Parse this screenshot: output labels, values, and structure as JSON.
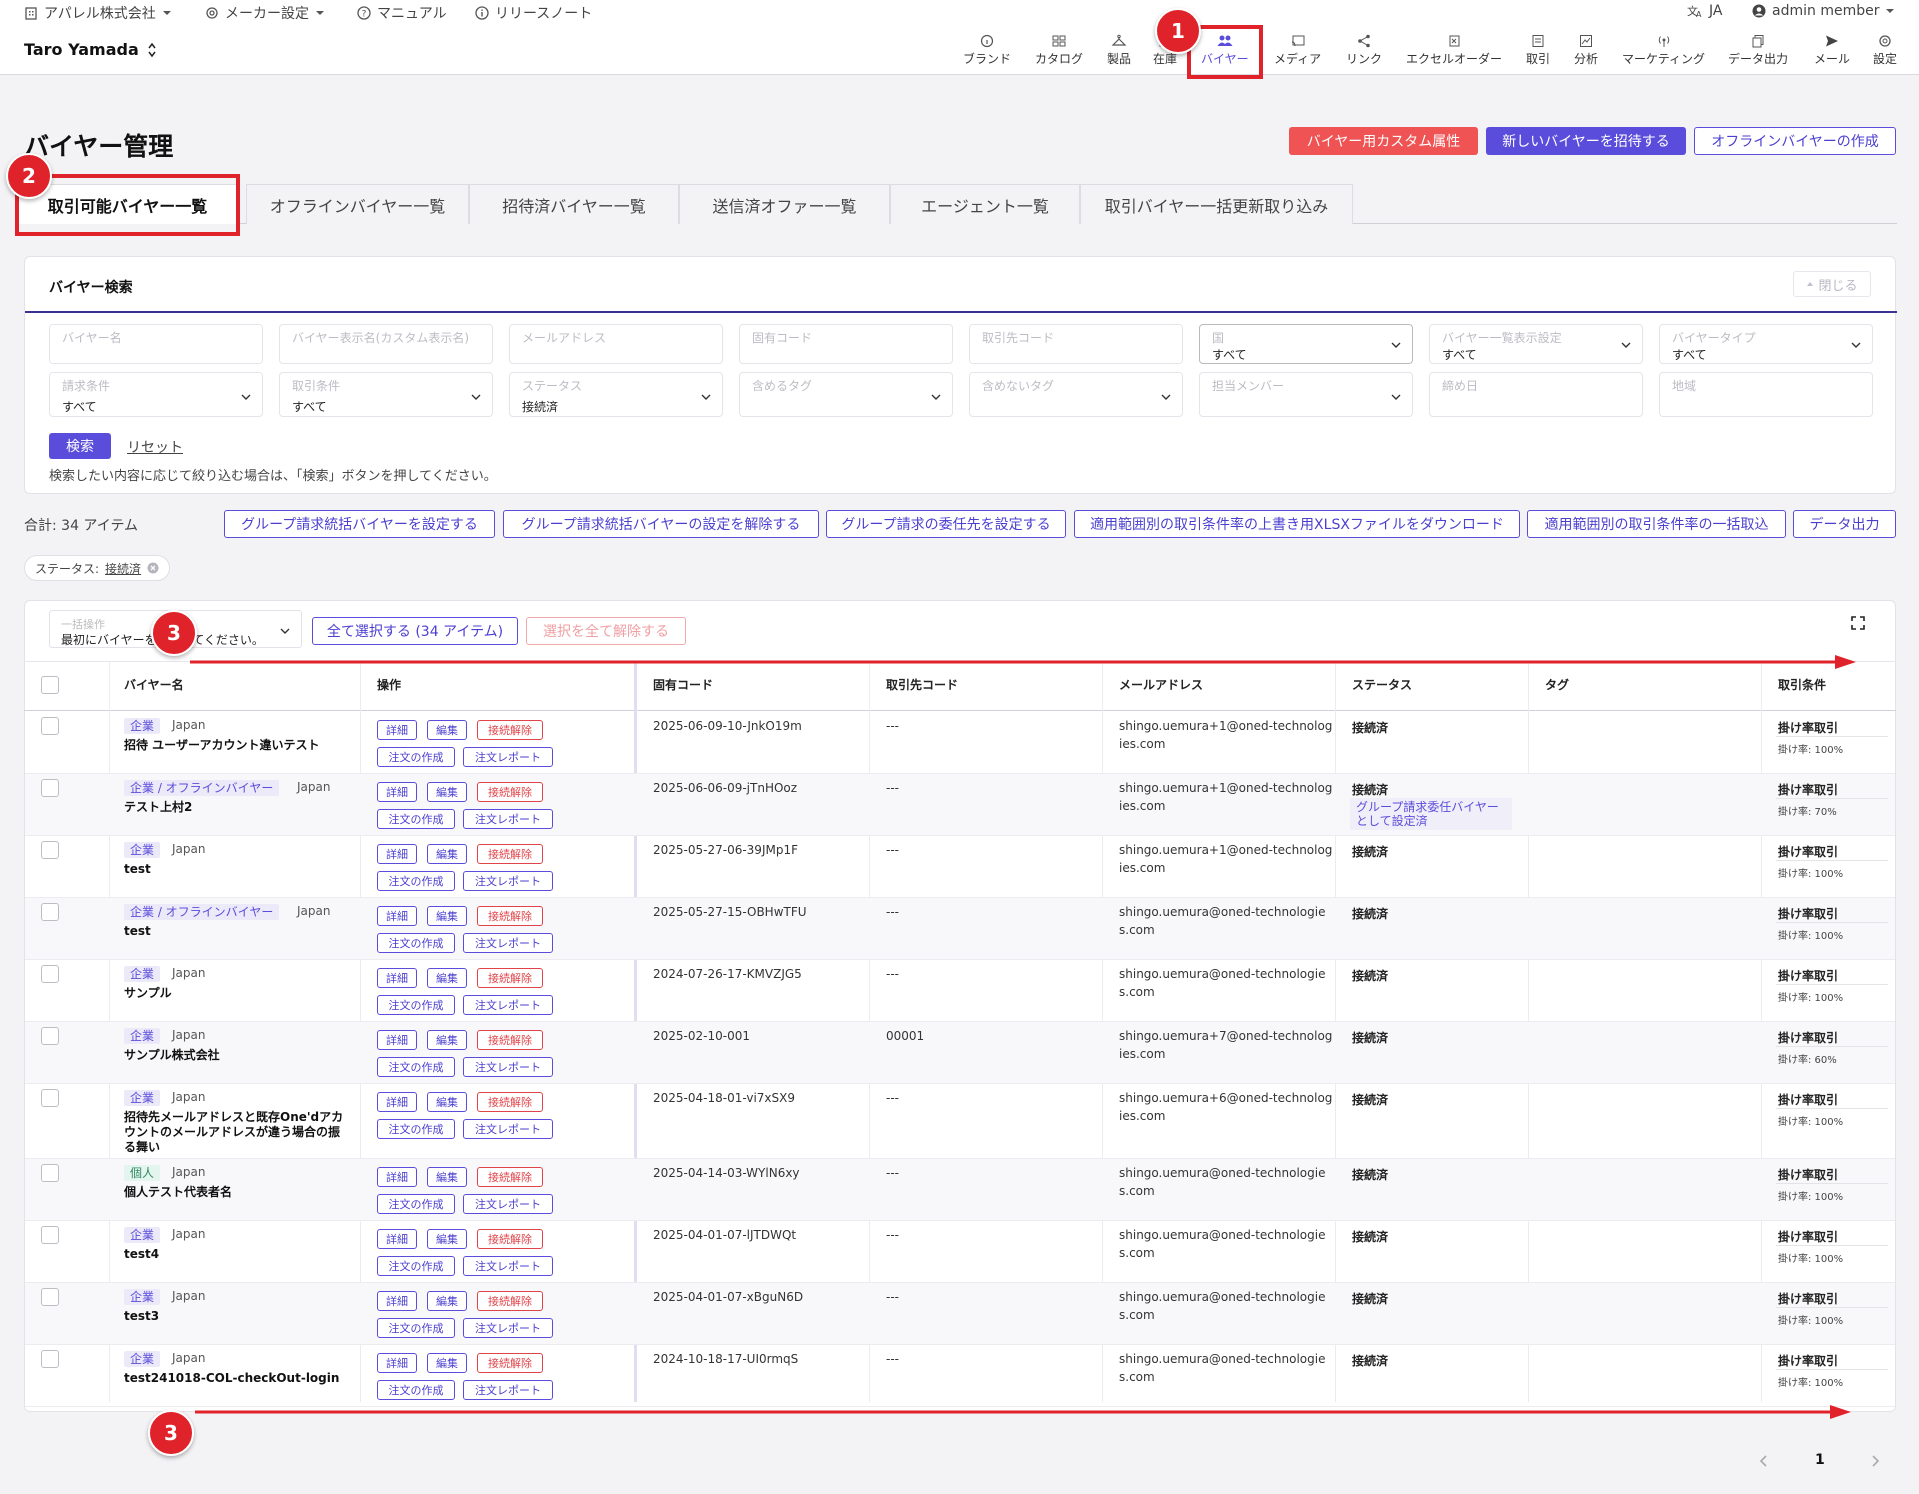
{
  "topbar": {
    "company": "アパレル株式会社",
    "maker_settings": "メーカー設定",
    "manual": "マニュアル",
    "release_notes": "リリースノート",
    "lang": "JA",
    "account": "admin member"
  },
  "nav": {
    "user": "Taro Yamada",
    "items": [
      "ブランド",
      "カタログ",
      "製品",
      "在庫",
      "バイヤー",
      "メディア",
      "リンク",
      "エクセルオーダー",
      "取引",
      "分析",
      "マーケティング",
      "データ出力",
      "メール",
      "設定"
    ]
  },
  "page": {
    "title": "バイヤー管理",
    "btn_custom_attr": "バイヤー用カスタム属性",
    "btn_invite": "新しいバイヤーを招待する",
    "btn_offline": "オフラインバイヤーの作成"
  },
  "tabs": [
    "取引可能バイヤー一覧",
    "オフラインバイヤー一覧",
    "招待済バイヤー一覧",
    "送信済オファー一覧",
    "エージェント一覧",
    "取引バイヤー一括更新取り込み"
  ],
  "search": {
    "title": "バイヤー検索",
    "close": "閉じる",
    "fields": {
      "buyer_name": "バイヤー名",
      "display_name": "バイヤー表示名(カスタム表示名)",
      "email": "メールアドレス",
      "code": "固有コード",
      "partner_code": "取引先コード",
      "country_label": "国",
      "country_value": "すべて",
      "list_setting_label": "バイヤー一覧表示設定",
      "list_setting_value": "すべて",
      "type_label": "バイヤータイプ",
      "type_value": "すべて",
      "billing_label": "請求条件",
      "billing_value": "すべて",
      "trade_label": "取引条件",
      "trade_value": "すべて",
      "status_label": "ステータス",
      "status_value": "接続済",
      "include_tags": "含めるタグ",
      "exclude_tags": "含めないタグ",
      "member": "担当メンバー",
      "closing_day": "締め日",
      "region": "地域"
    },
    "btn_search": "検索",
    "btn_reset": "リセット",
    "hint": "検索したい内容に応じて絞り込む場合は、「検索」ボタンを押してください。"
  },
  "actions": {
    "total": "合計: 34 アイテム",
    "b1": "グループ請求統括バイヤーを設定する",
    "b2": "グループ請求統括バイヤーの設定を解除する",
    "b3": "グループ請求の委任先を設定する",
    "b4": "適用範囲別の取引条件率の上書き用XLSXファイルをダウンロード",
    "b5": "適用範囲別の取引条件率の一括取込",
    "b6": "データ出力",
    "filter_chip_prefix": "ステータス: ",
    "filter_chip_value": "接続済"
  },
  "bulk": {
    "label": "一括操作",
    "value": "最初にバイヤーを選択してください。",
    "select_all": "全て選択する (34 アイテム)",
    "deselect_all": "選択を全て解除する"
  },
  "table": {
    "headers": [
      "バイヤー名",
      "操作",
      "固有コード",
      "取引先コード",
      "メールアドレス",
      "ステータス",
      "タグ",
      "取引条件"
    ],
    "btn_detail": "詳細",
    "btn_edit": "編集",
    "btn_disconnect": "接続解除",
    "btn_order": "注文の作成",
    "btn_report": "注文レポート",
    "rows": [
      {
        "type": "企業",
        "country": "Japan",
        "name1": "招待 ユーザーアカウント違いテスト",
        "name2": "",
        "name3": "",
        "code": "2025-06-09-10-JnkO19m",
        "partner": "---",
        "email1": "shingo.uemura+1@oned-technolog",
        "email2": "ies.com",
        "status": "接続済",
        "group1": "",
        "group2": "",
        "cond": "掛け率取引",
        "rate": "掛け率: 100%"
      },
      {
        "type": "企業 / オフラインバイヤー",
        "country": "Japan",
        "name1": "テスト上村2",
        "name2": "",
        "name3": "",
        "code": "2025-06-06-09-jTnHOoz",
        "partner": "---",
        "email1": "shingo.uemura+1@oned-technolog",
        "email2": "ies.com",
        "status": "接続済",
        "group1": "グループ請求委任バイヤー",
        "group2": "として設定済",
        "cond": "掛け率取引",
        "rate": "掛け率: 70%"
      },
      {
        "type": "企業",
        "country": "Japan",
        "name1": "test",
        "name2": "",
        "name3": "",
        "code": "2025-05-27-06-39JMp1F",
        "partner": "---",
        "email1": "shingo.uemura+1@oned-technolog",
        "email2": "ies.com",
        "status": "接続済",
        "group1": "",
        "group2": "",
        "cond": "掛け率取引",
        "rate": "掛け率: 100%"
      },
      {
        "type": "企業 / オフラインバイヤー",
        "country": "Japan",
        "name1": "test",
        "name2": "",
        "name3": "",
        "code": "2025-05-27-15-OBHwTFU",
        "partner": "---",
        "email1": "shingo.uemura@oned-technologie",
        "email2": "s.com",
        "status": "接続済",
        "group1": "",
        "group2": "",
        "cond": "掛け率取引",
        "rate": "掛け率: 100%"
      },
      {
        "type": "企業",
        "country": "Japan",
        "name1": "サンプル",
        "name2": "",
        "name3": "",
        "code": "2024-07-26-17-KMVZJG5",
        "partner": "---",
        "email1": "shingo.uemura@oned-technologie",
        "email2": "s.com",
        "status": "接続済",
        "group1": "",
        "group2": "",
        "cond": "掛け率取引",
        "rate": "掛け率: 100%"
      },
      {
        "type": "企業",
        "country": "Japan",
        "name1": "サンプル株式会社",
        "name2": "",
        "name3": "",
        "code": "2025-02-10-001",
        "partner": "00001",
        "email1": "shingo.uemura+7@oned-technolog",
        "email2": "ies.com",
        "status": "接続済",
        "group1": "",
        "group2": "",
        "cond": "掛け率取引",
        "rate": "掛け率: 60%"
      },
      {
        "type": "企業",
        "country": "Japan",
        "name1": "招待先メールアドレスと既存One'dアカ",
        "name2": "ウントのメールアドレスが違う場合の振",
        "name3": "る舞い",
        "code": "2025-04-18-01-vi7xSX9",
        "partner": "---",
        "email1": "shingo.uemura+6@oned-technolog",
        "email2": "ies.com",
        "status": "接続済",
        "group1": "",
        "group2": "",
        "cond": "掛け率取引",
        "rate": "掛け率: 100%"
      },
      {
        "type": "個人",
        "country": "Japan",
        "name1": "個人テスト代表者名",
        "name2": "",
        "name3": "",
        "code": "2025-04-14-03-WYlN6xy",
        "partner": "---",
        "email1": "shingo.uemura@oned-technologie",
        "email2": "s.com",
        "status": "接続済",
        "group1": "",
        "group2": "",
        "cond": "掛け率取引",
        "rate": "掛け率: 100%"
      },
      {
        "type": "企業",
        "country": "Japan",
        "name1": "test4",
        "name2": "",
        "name3": "",
        "code": "2025-04-01-07-lJTDWQt",
        "partner": "---",
        "email1": "shingo.uemura@oned-technologie",
        "email2": "s.com",
        "status": "接続済",
        "group1": "",
        "group2": "",
        "cond": "掛け率取引",
        "rate": "掛け率: 100%"
      },
      {
        "type": "企業",
        "country": "Japan",
        "name1": "test3",
        "name2": "",
        "name3": "",
        "code": "2025-04-01-07-xBguN6D",
        "partner": "---",
        "email1": "shingo.uemura@oned-technologie",
        "email2": "s.com",
        "status": "接続済",
        "group1": "",
        "group2": "",
        "cond": "掛け率取引",
        "rate": "掛け率: 100%"
      },
      {
        "type": "企業",
        "country": "Japan",
        "name1": "test241018-COL-checkOut-login",
        "name2": "",
        "name3": "",
        "code": "2024-10-18-17-UI0rmqS",
        "partner": "---",
        "email1": "shingo.uemura@oned-technologie",
        "email2": "s.com",
        "status": "接続済",
        "group1": "",
        "group2": "",
        "cond": "掛け率取引",
        "rate": "掛け率: 100%"
      }
    ]
  },
  "pagination": {
    "current": "1"
  },
  "annotations": [
    "1",
    "2",
    "3",
    "3"
  ],
  "colors": {
    "accent": "#5b4ddb",
    "danger": "#e0444a",
    "annotation": "#e0232a"
  }
}
